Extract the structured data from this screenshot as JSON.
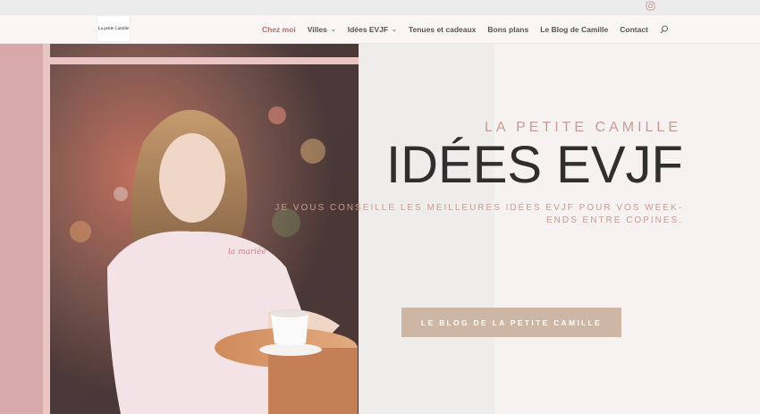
{
  "topbar": {
    "social_icon": "instagram-icon"
  },
  "header": {
    "logo_text": "La petite Camille",
    "nav": [
      {
        "label": "Chez moi",
        "active": true,
        "dropdown": false
      },
      {
        "label": "Villes",
        "active": false,
        "dropdown": true
      },
      {
        "label": "Idées EVJF",
        "active": false,
        "dropdown": true
      },
      {
        "label": "Tenues et cadeaux",
        "active": false,
        "dropdown": false
      },
      {
        "label": "Bons plans",
        "active": false,
        "dropdown": false
      },
      {
        "label": "Le Blog de Camille",
        "active": false,
        "dropdown": false
      },
      {
        "label": "Contact",
        "active": false,
        "dropdown": false
      }
    ],
    "search_icon": "search-icon"
  },
  "hero": {
    "kicker": "LA PETITE CAMILLE",
    "title": "IDÉES EVJF",
    "subtitle": "JE VOUS CONSEILLE LES MEILLEURES IDÉES EVJF POUR VOS WEEK-ENDS ENTRE COPINES.",
    "cta_label": "LE BLOG DE LA PETITE CAMILLE",
    "sweater_text": "la mariée"
  },
  "colors": {
    "accent": "#b76f6a",
    "kicker": "#c79b93",
    "cta_bg": "#cdb6a4",
    "title": "#2f2f2f"
  }
}
